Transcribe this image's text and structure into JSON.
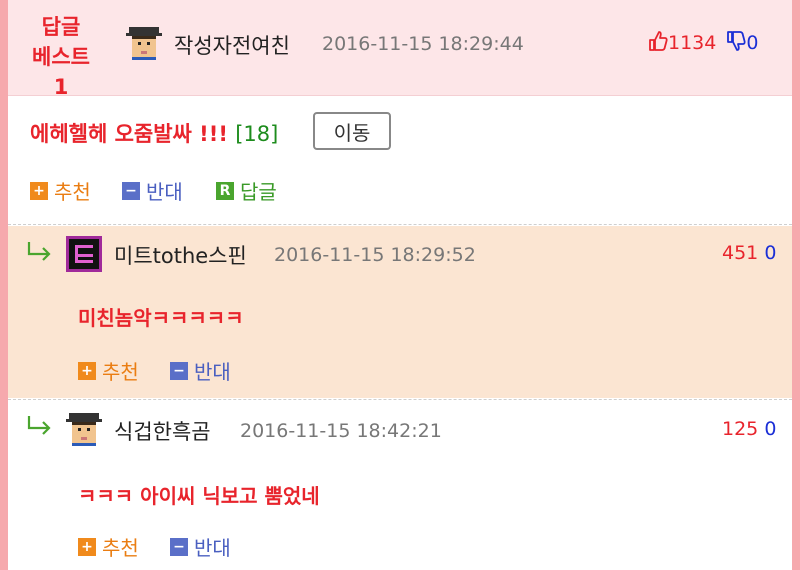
{
  "best_reply": {
    "badge_line1": "답글",
    "badge_line2": "베스트1",
    "author": "작성자전여친",
    "date": "2016-11-15 18:29:44",
    "up_votes": "1134",
    "down_votes": "0",
    "title": "에헤헬헤 오줌발싸 !!!",
    "reply_count": "[18]",
    "move_button": "이동",
    "actions": {
      "recommend": "추천",
      "oppose": "반대",
      "reply": "답글"
    }
  },
  "replies": [
    {
      "author": "미트tothe스핀",
      "date": "2016-11-15 18:29:52",
      "up_votes": "451",
      "down_votes": "0",
      "text": "미친놈악ㅋㅋㅋㅋㅋ",
      "recommend": "추천",
      "oppose": "반대"
    },
    {
      "author": "식겁한흑곰",
      "date": "2016-11-15 18:42:21",
      "up_votes": "125",
      "down_votes": "0",
      "text": "ㅋㅋㅋ 아이씨 닉보고 뿜었네",
      "recommend": "추천",
      "oppose": "반대"
    }
  ],
  "icons": {
    "action_plus": "+",
    "action_minus": "−",
    "action_reply": "R"
  },
  "colors": {
    "accent_red": "#e8242c",
    "down_blue": "#1b2fd6",
    "best_bg": "#fde6e8",
    "reply_highlight_bg": "#fbe5d2"
  }
}
